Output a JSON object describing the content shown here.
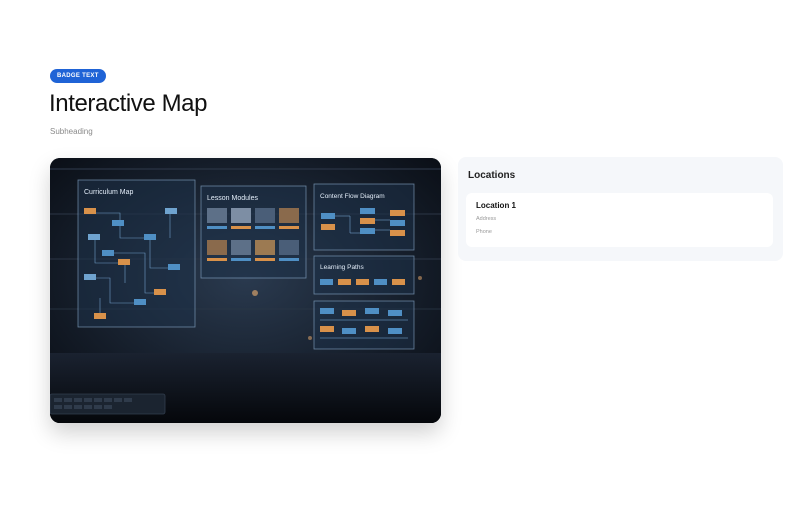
{
  "header": {
    "badge": "BADGE TEXT",
    "title": "Interactive Map",
    "subtitle": "Subheading"
  },
  "hero_image": {
    "panels": {
      "curriculum": "Curriculum Map",
      "lessons": "Lesson Modules",
      "content_flow": "Content Flow Diagram",
      "learning_paths": "Learning Paths"
    }
  },
  "locations": {
    "title": "Locations",
    "items": [
      {
        "name": "Location 1",
        "address": "Address",
        "phone": "Phone"
      }
    ]
  }
}
